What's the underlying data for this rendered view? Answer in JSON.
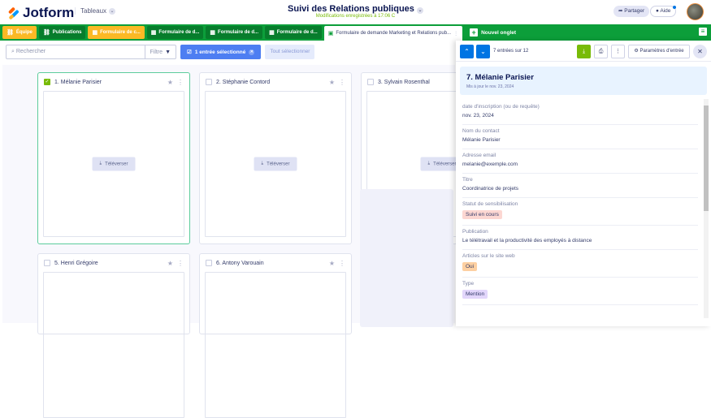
{
  "header": {
    "brand": "Jotform",
    "workspace": "Tableaux",
    "title": "Suivi des Relations publiques",
    "saved": "Modifications enregistrées à 17:06 C",
    "share": "Partager",
    "help": "Aide"
  },
  "tabs": [
    {
      "label": "Équipe",
      "icon": "link-icon"
    },
    {
      "label": "Publications",
      "icon": "link-icon"
    },
    {
      "label": "Formulaire de c...",
      "icon": "grid-icon"
    },
    {
      "label": "Formulaire de d...",
      "icon": "grid-icon"
    },
    {
      "label": "Formulaire de d...",
      "icon": "grid-icon"
    },
    {
      "label": "Formulaire de d...",
      "icon": "grid-icon"
    },
    {
      "label": "Formulaire de demande Marketing et Relations pub...",
      "icon": "form-icon"
    }
  ],
  "new_tab": "Nouvel onglet",
  "toolbar": {
    "search_placeholder": "Rechercher",
    "filter": "Filtre",
    "selected": "1 entrée sélectionné",
    "select_all": "Tout sélectionner"
  },
  "cards": [
    {
      "name": "1. Mélanie Parisier",
      "checked": true,
      "upload": "Téléverser"
    },
    {
      "name": "2. Stéphanie Contord",
      "checked": false,
      "upload": "Téléverser"
    },
    {
      "name": "3. Sylvain Rosenthal",
      "checked": false,
      "upload": "Téléverser"
    },
    {
      "name": "5. Henri Grégoire",
      "checked": false
    },
    {
      "name": "6. Antony Varouain",
      "checked": false
    }
  ],
  "panel": {
    "count": "7 entrées sur 12",
    "settings": "Paramètres d'entrée",
    "name": "7. Mélanie Parisier",
    "updated": "Mis à jour le nov. 23, 2024",
    "fields": [
      {
        "label": "date d'inscription (ou de requête)",
        "value": "nov. 23, 2024"
      },
      {
        "label": "Nom du contact",
        "value": "Mélanie Parisier"
      },
      {
        "label": "Adresse email",
        "value": "melanie@exemple.com"
      },
      {
        "label": "Titre",
        "value": "Coordinatrice de projets"
      },
      {
        "label": "Statut de sensibilisation",
        "value": "Suivi en cours",
        "tag": "#fcd7d2"
      },
      {
        "label": "Publication",
        "value": "Le télétravail et la productivité des employés à distance"
      },
      {
        "label": "Articles sur le site web",
        "value": "Oui",
        "tag": "#fdd0a2"
      },
      {
        "label": "Type",
        "value": "Mention",
        "tag": "#e2d6fb"
      }
    ]
  },
  "colors": {
    "tabbar": "#0c9e3a",
    "accent": "#0075e3",
    "brand_yellow": "#fbb925"
  }
}
